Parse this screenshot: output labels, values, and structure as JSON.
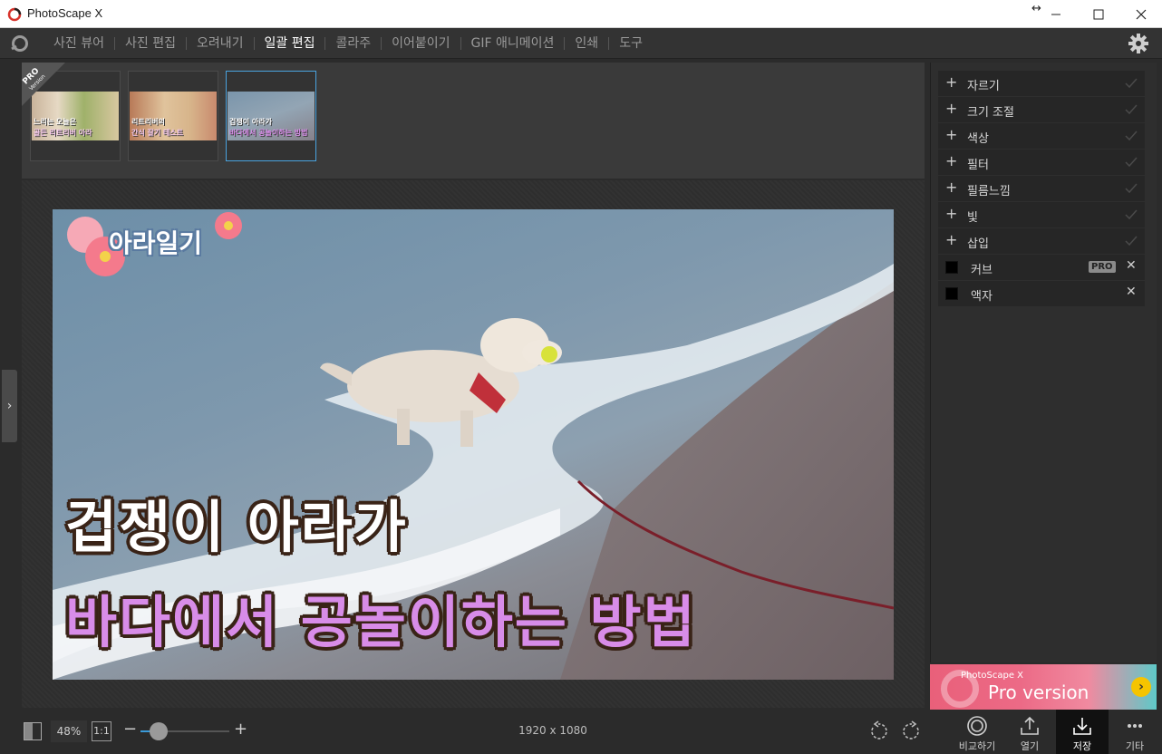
{
  "window": {
    "title": "PhotoScape X"
  },
  "menu": {
    "items": [
      "사진 뷰어",
      "사진 편집",
      "오려내기",
      "일괄 편집",
      "콜라주",
      "이어붙이기",
      "GIF 애니메이션",
      "인쇄",
      "도구"
    ],
    "active_index": 3
  },
  "thumbnails": {
    "pro_badge": "PRO",
    "pro_badge_sub": "Version",
    "items": [
      {
        "caption_top": "느리는 오늘은",
        "caption_bottom": "골든 리트리버 아라",
        "selected": false
      },
      {
        "caption_top": "리트리버의",
        "caption_bottom": "간식 잘기 테스트",
        "selected": false
      },
      {
        "caption_top": "겁쟁이 아라가",
        "caption_bottom": "바다에서 공놀이하는 방법",
        "selected": true
      }
    ]
  },
  "preview": {
    "logo_text": "아라일기",
    "line1": "겁쟁이 아라가",
    "line2": "바다에서 공놀이하는 방법"
  },
  "tools": {
    "expandable": [
      {
        "label": "자르기"
      },
      {
        "label": "크기 조절"
      },
      {
        "label": "색상"
      },
      {
        "label": "필터"
      },
      {
        "label": "필름느낌"
      },
      {
        "label": "빛"
      },
      {
        "label": "삽입"
      }
    ],
    "toggles": [
      {
        "label": "커브",
        "badge": "PRO"
      },
      {
        "label": "액자",
        "badge": ""
      }
    ]
  },
  "promo": {
    "brand": "PhotoScape X",
    "title": "Pro version"
  },
  "bottom": {
    "zoom_percent": "48%",
    "zoom_level": 0.2,
    "one_to_one": "1:1",
    "dimensions": "1920 x 1080",
    "buttons": {
      "compare": "비교하기",
      "open": "열기",
      "save": "저장",
      "more": "기타"
    }
  },
  "colors": {
    "accent": "#3a9ad9",
    "promo": "#e9607a",
    "caption_pink": "#d88ce8"
  }
}
